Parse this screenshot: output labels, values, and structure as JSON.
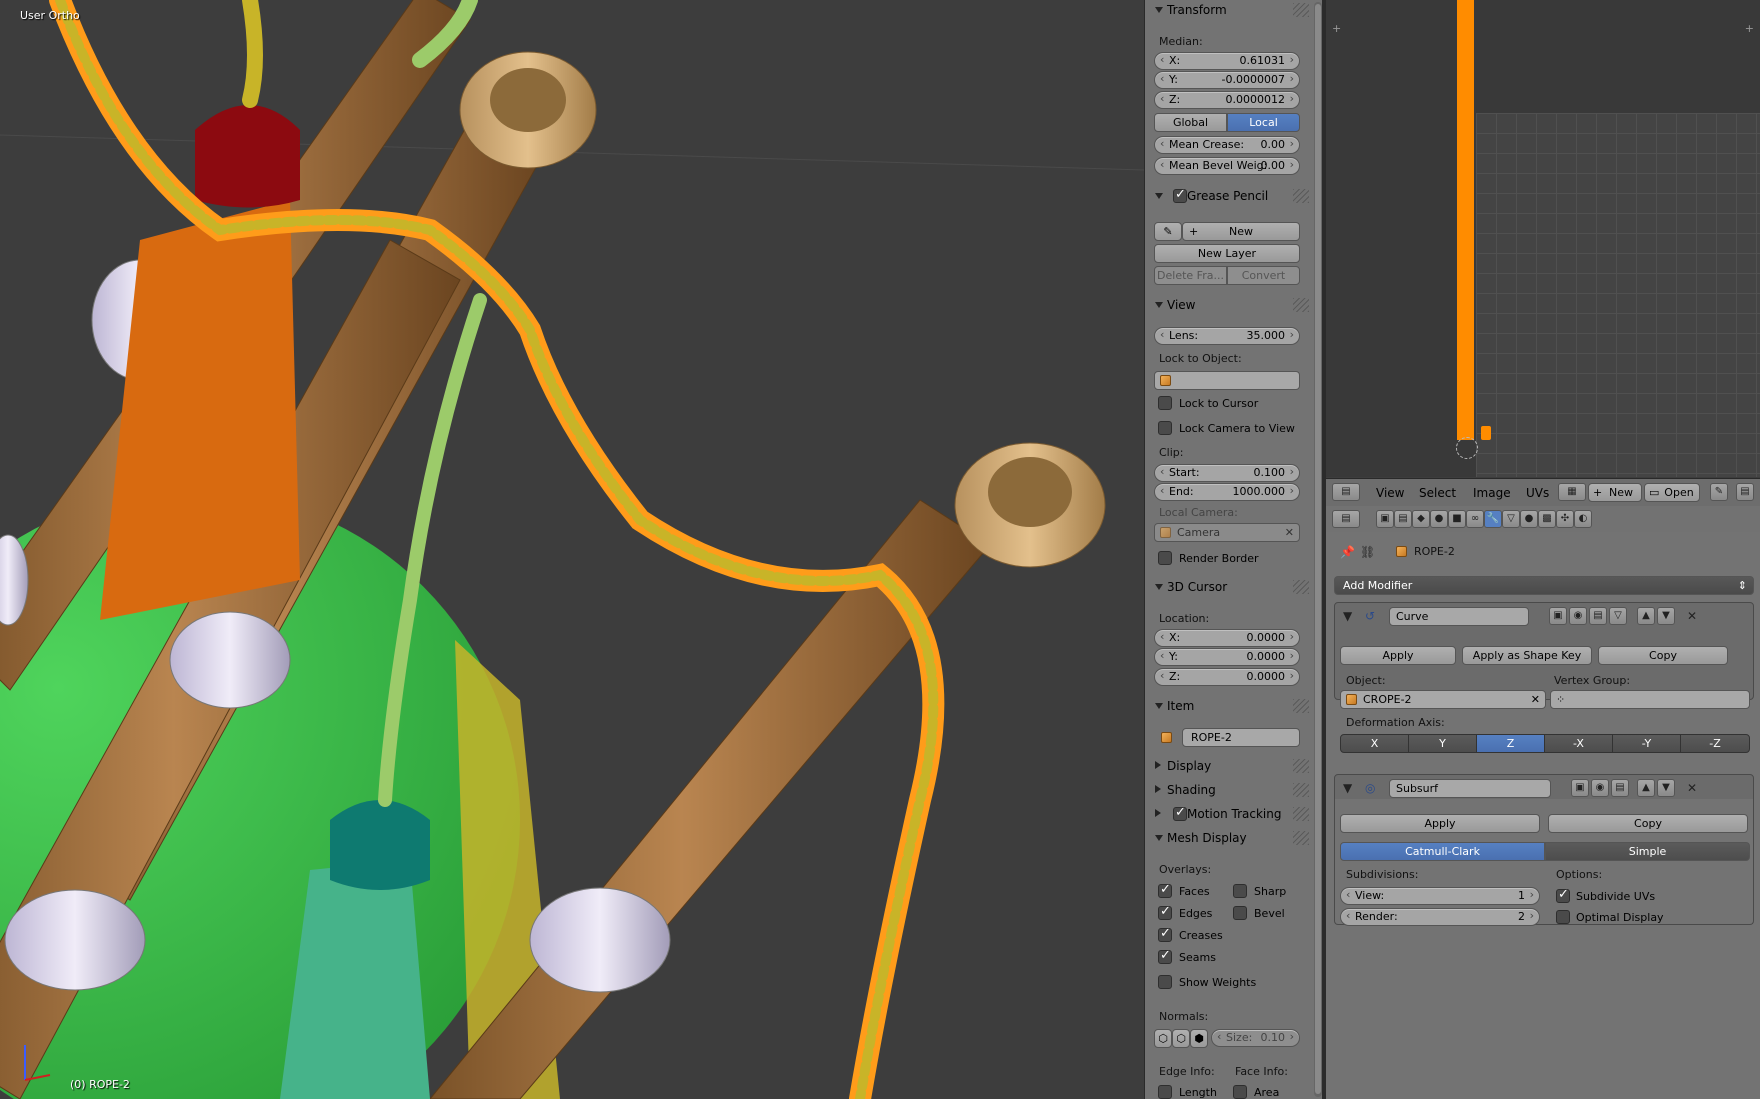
{
  "viewport": {
    "view_name": "User Ortho",
    "object_label": "(0) ROPE-2"
  },
  "npanel": {
    "transform": {
      "header": "Transform",
      "median_label": "Median:",
      "x_label": "X:",
      "x_value": "0.61031",
      "y_label": "Y:",
      "y_value": "-0.0000007",
      "z_label": "Z:",
      "z_value": "0.0000012",
      "global_label": "Global",
      "local_label": "Local",
      "mean_crease_label": "Mean Crease:",
      "mean_crease_value": "0.00",
      "mean_bevel_label": "Mean Bevel Weig:",
      "mean_bevel_value": "0.00"
    },
    "grease_pencil": {
      "header": "Grease Pencil",
      "new_label": "New",
      "new_layer_label": "New Layer",
      "delete_frame_label": "Delete Fra...",
      "convert_label": "Convert"
    },
    "view": {
      "header": "View",
      "lens_label": "Lens:",
      "lens_value": "35.000",
      "lock_to_object_label": "Lock to Object:",
      "lock_to_cursor_label": "Lock to Cursor",
      "lock_camera_label": "Lock Camera to View",
      "clip_label": "Clip:",
      "start_label": "Start:",
      "start_value": "0.100",
      "end_label": "End:",
      "end_value": "1000.000",
      "local_camera_label": "Local Camera:",
      "camera_value": "Camera",
      "render_border_label": "Render Border"
    },
    "cursor_3d": {
      "header": "3D Cursor",
      "location_label": "Location:",
      "x_label": "X:",
      "x_value": "0.0000",
      "y_label": "Y:",
      "y_value": "0.0000",
      "z_label": "Z:",
      "z_value": "0.0000"
    },
    "item": {
      "header": "Item",
      "name_value": "ROPE-2"
    },
    "display_header": "Display",
    "shading_header": "Shading",
    "motion_tracking_header": "Motion Tracking",
    "mesh_display": {
      "header": "Mesh Display",
      "overlays_label": "Overlays:",
      "faces_label": "Faces",
      "sharp_label": "Sharp",
      "edges_label": "Edges",
      "bevel_label": "Bevel",
      "creases_label": "Creases",
      "seams_label": "Seams",
      "show_weights_label": "Show Weights",
      "normals_label": "Normals:",
      "size_label": "Size:",
      "size_value": "0.10",
      "edge_info_label": "Edge Info:",
      "face_info_label": "Face Info:",
      "length_label": "Length",
      "area_label": "Area"
    }
  },
  "uv_header": {
    "view_menu": "View",
    "select_menu": "Select",
    "image_menu": "Image",
    "uvs_menu": "UVs",
    "new_label": "New",
    "open_label": "Open"
  },
  "properties": {
    "breadcrumb_object": "ROPE-2",
    "add_modifier_label": "Add Modifier",
    "curve_modifier": {
      "name": "Curve",
      "apply_label": "Apply",
      "apply_shape_key_label": "Apply as Shape Key",
      "copy_label": "Copy",
      "object_label": "Object:",
      "object_value": "CROPE-2",
      "vertex_group_label": "Vertex Group:",
      "deformation_axis_label": "Deformation Axis:",
      "axes": [
        "X",
        "Y",
        "Z",
        "-X",
        "-Y",
        "-Z"
      ],
      "selected_axis": "Z"
    },
    "subsurf_modifier": {
      "name": "Subsurf",
      "apply_label": "Apply",
      "copy_label": "Copy",
      "catmull_label": "Catmull-Clark",
      "simple_label": "Simple",
      "subdivisions_label": "Subdivisions:",
      "view_label": "View:",
      "view_value": "1",
      "render_label": "Render:",
      "render_value": "2",
      "options_label": "Options:",
      "subdivide_uvs_label": "Subdivide UVs",
      "optimal_display_label": "Optimal Display"
    }
  },
  "colors": {
    "accent_blue": "#5680c2",
    "uv_orange": "#ff8c00",
    "rope_yellow": "#c8b428",
    "wood": "#a6743c",
    "bag_green": "#3cb84a",
    "tassel_red": "#8c0a10",
    "tassel_orange": "#d86a10"
  }
}
